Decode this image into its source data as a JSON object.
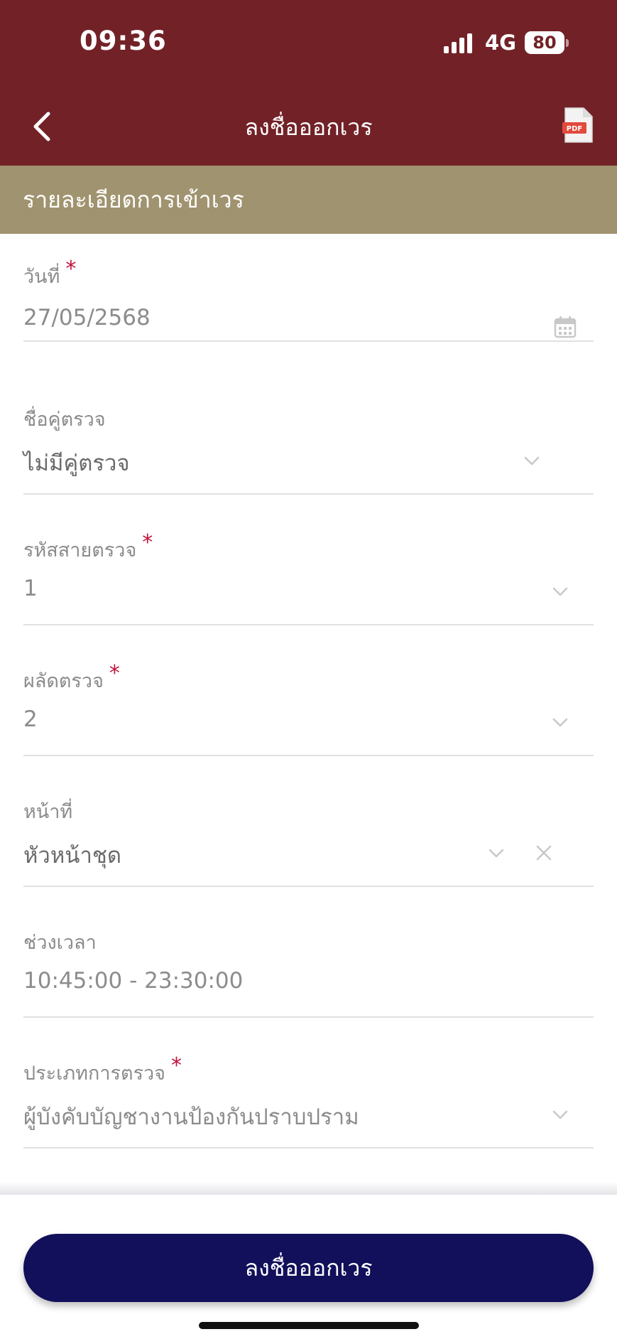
{
  "status_bar": {
    "time": "09:36",
    "network": "4G",
    "battery": "80"
  },
  "header": {
    "title": "ลงชื่อออกเวร",
    "pdf_icon_label": "PDF",
    "back_icon": "chevron-left-icon",
    "pdf_icon": "pdf-file-icon"
  },
  "section": {
    "title": "รายละเอียดการเข้าเวร"
  },
  "fields": [
    {
      "label": "วันที่",
      "required": "*",
      "value": "27/05/2568"
    },
    {
      "label": "ชื่อคู่ตรวจ",
      "required": "",
      "value": "ไม่มีคู่ตรวจ"
    },
    {
      "label": "รหัสสายตรวจ",
      "required": "*",
      "value": "1"
    },
    {
      "label": "ผลัดตรวจ",
      "required": "*",
      "value": "2"
    },
    {
      "label": "หน้าที่",
      "required": "",
      "value": "หัวหน้าชุด"
    },
    {
      "label": "ช่วงเวลา",
      "required": "",
      "value": "10:45:00 - 23:30:00"
    },
    {
      "label": "ประเภทการตรวจ",
      "required": "*",
      "value": "ผู้บังคับบัญชางานป้องกันปราบปราม"
    }
  ],
  "footer": {
    "submit_label": "ลงชื่อออกเวร"
  },
  "colors": {
    "header_bg": "#722227",
    "section_bg": "#a0936f",
    "required": "#c0143c",
    "button_bg": "#12105a"
  }
}
